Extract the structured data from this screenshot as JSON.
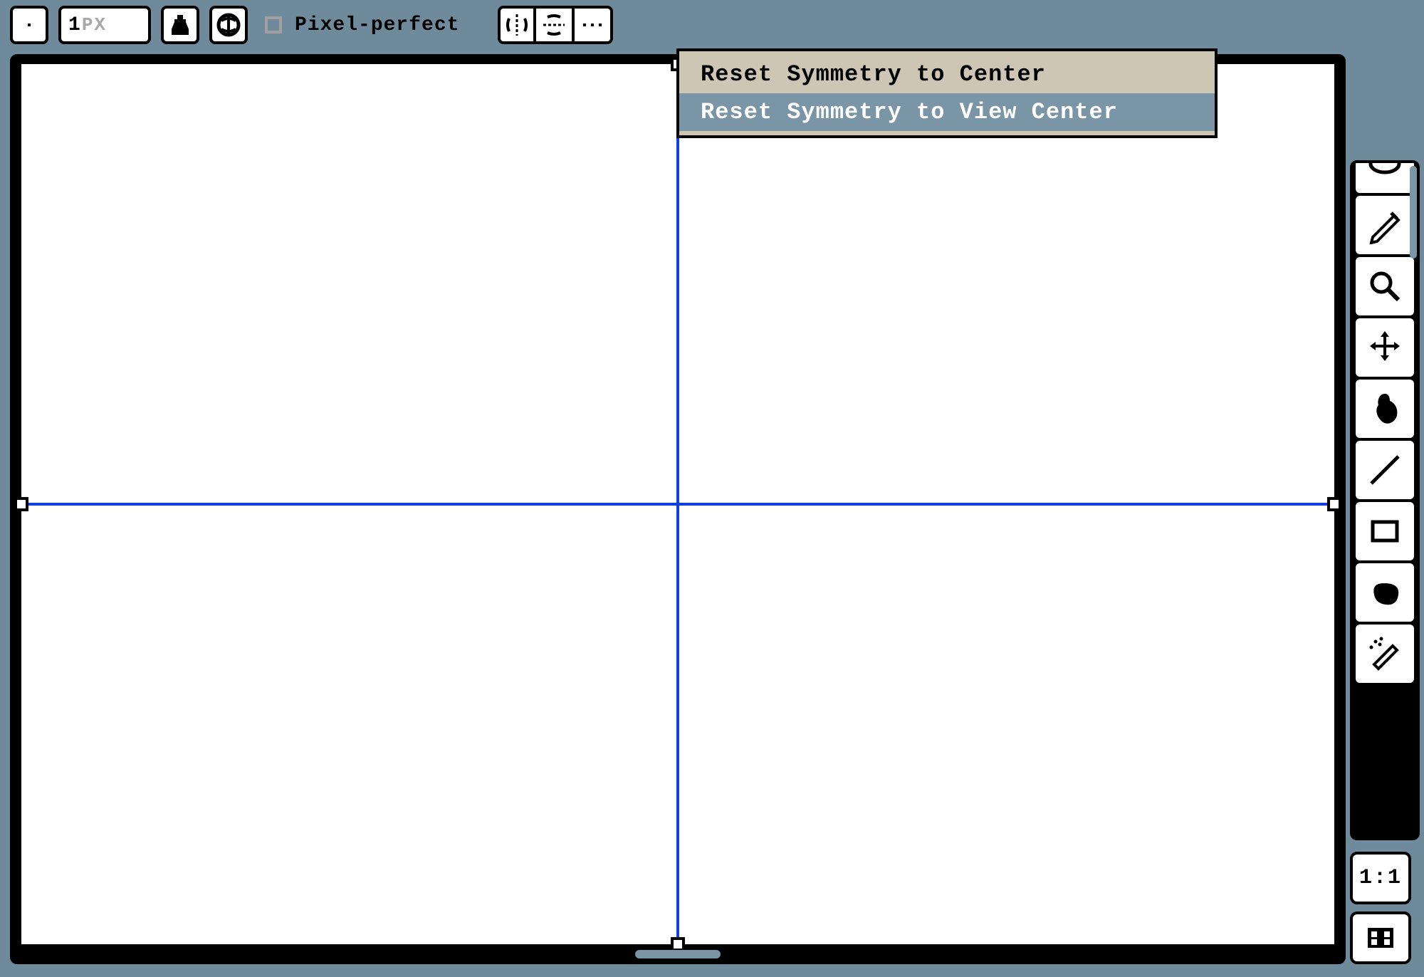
{
  "toolbar": {
    "brush_size_value": "1",
    "brush_size_unit": "PX",
    "pixel_perfect_label": "Pixel-perfect"
  },
  "symmetry_menu": {
    "items": [
      {
        "label": "Reset Symmetry to Center",
        "highlighted": false
      },
      {
        "label": "Reset Symmetry to View Center",
        "highlighted": true
      }
    ]
  },
  "right_tools": [
    {
      "name": "eraser-tool-icon"
    },
    {
      "name": "pencil-tool-icon"
    },
    {
      "name": "zoom-tool-icon"
    },
    {
      "name": "move-tool-icon"
    },
    {
      "name": "bucket-tool-icon"
    },
    {
      "name": "line-tool-icon"
    },
    {
      "name": "rectangle-tool-icon"
    },
    {
      "name": "blob-tool-icon"
    },
    {
      "name": "spray-tool-icon"
    }
  ],
  "bottom_buttons": {
    "zoom_reset_label": "1:1"
  },
  "colors": {
    "bg": "#6f8a9a",
    "axis": "#1040e0",
    "menu_bg": "#cdc6b4",
    "highlight": "#7a95a5"
  }
}
